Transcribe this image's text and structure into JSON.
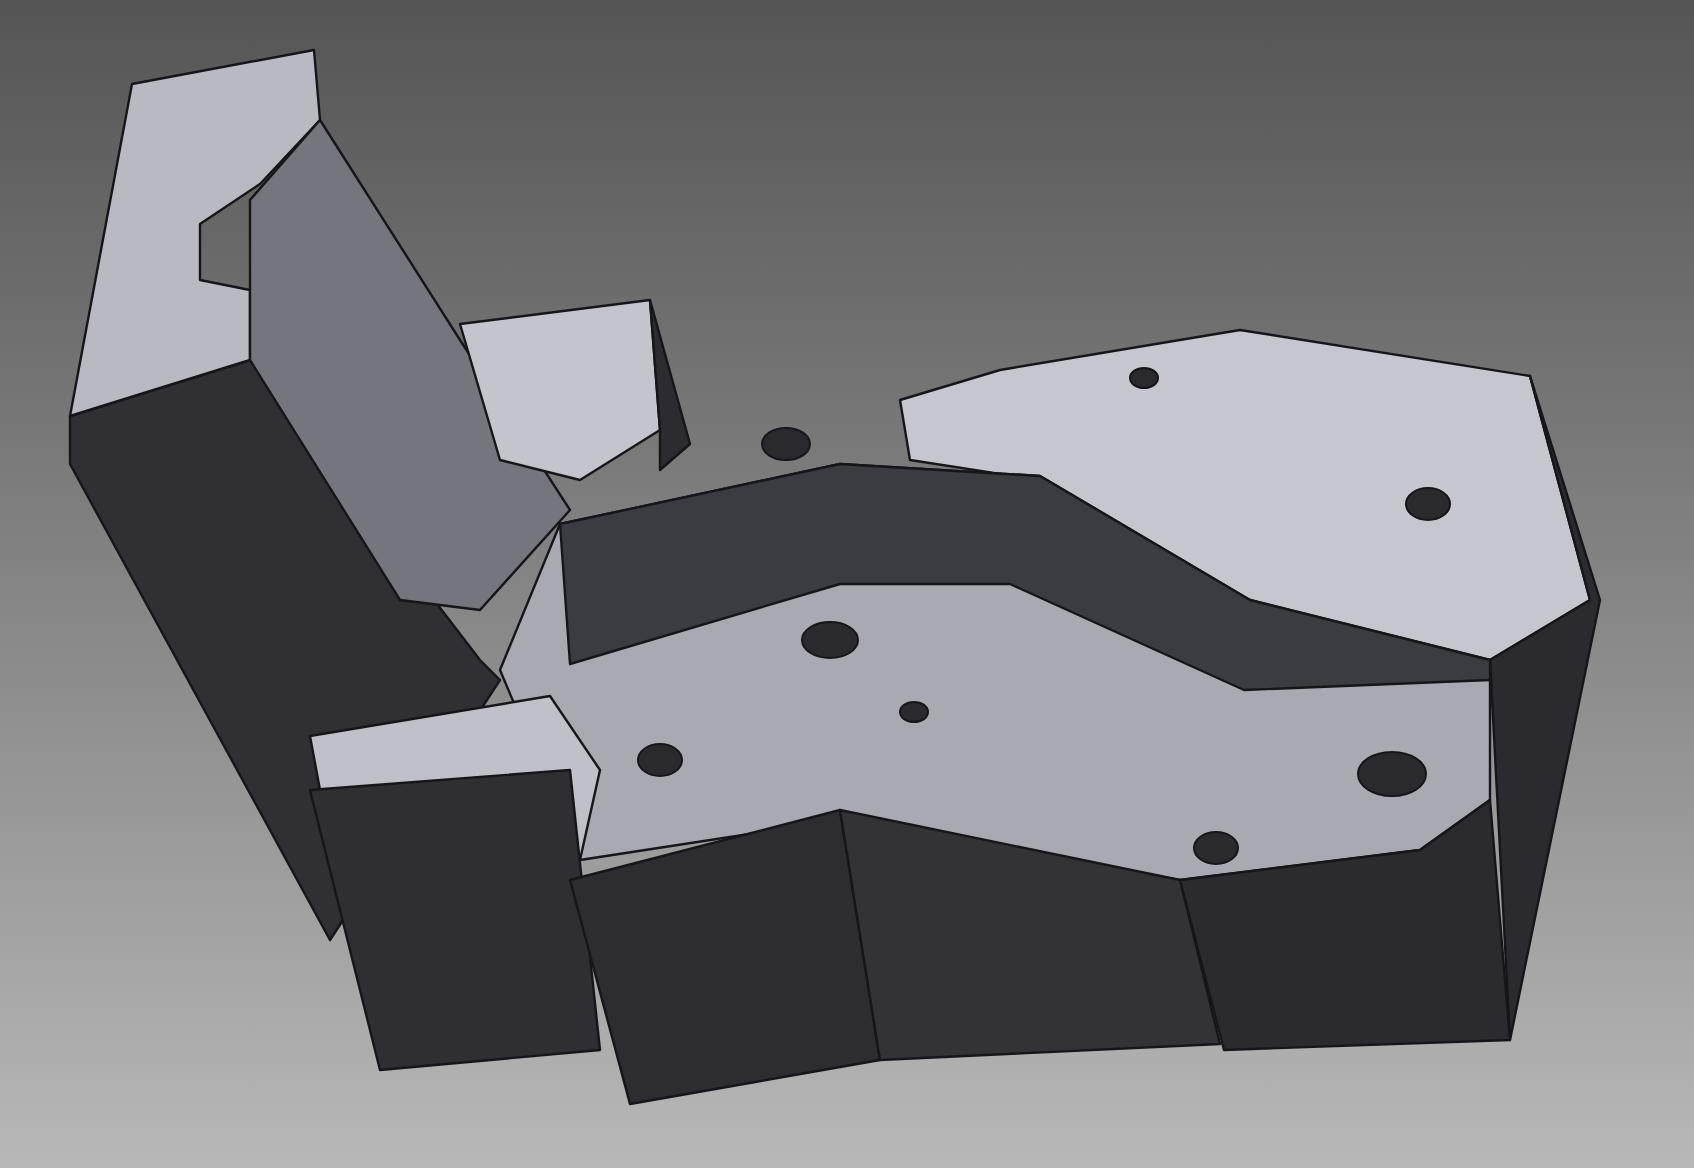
{
  "scene": {
    "kind": "cad-render"
  }
}
